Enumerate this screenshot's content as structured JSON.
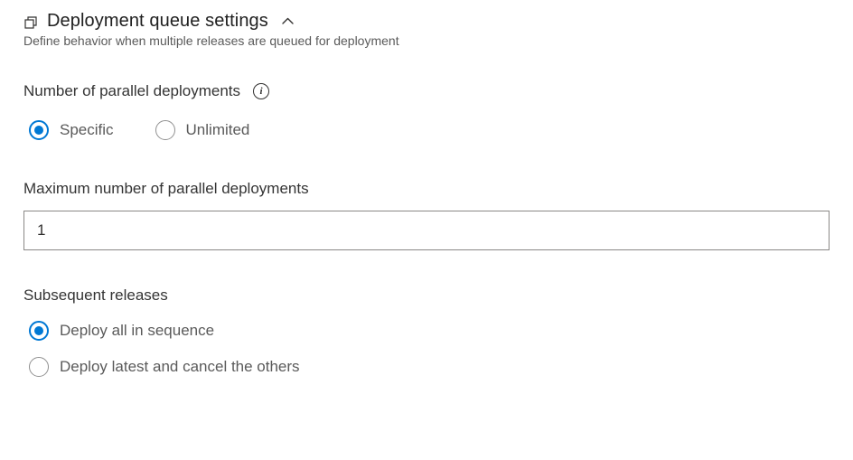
{
  "header": {
    "title": "Deployment queue settings",
    "subtitle": "Define behavior when multiple releases are queued for deployment"
  },
  "parallel": {
    "label": "Number of parallel deployments",
    "options": {
      "specific": "Specific",
      "unlimited": "Unlimited"
    }
  },
  "maximum": {
    "label": "Maximum number of parallel deployments",
    "value": "1"
  },
  "subsequent": {
    "label": "Subsequent releases",
    "options": {
      "sequence": "Deploy all in sequence",
      "cancel": "Deploy latest and cancel the others"
    }
  }
}
